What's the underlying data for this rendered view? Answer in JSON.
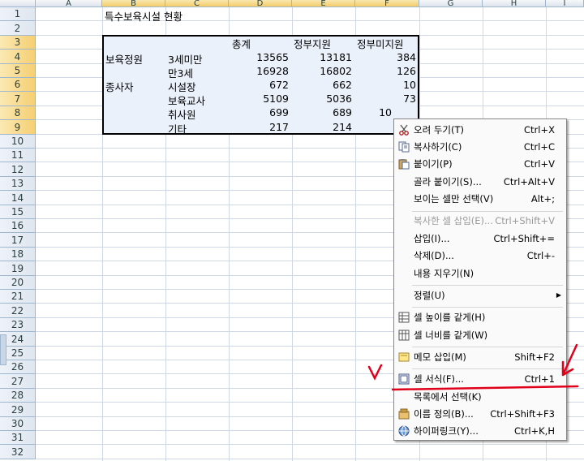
{
  "columns": [
    "A",
    "B",
    "C",
    "D",
    "E",
    "F",
    "G",
    "H",
    "I"
  ],
  "rows": [
    "1",
    "2",
    "3",
    "4",
    "5",
    "6",
    "7",
    "8",
    "9",
    "10",
    "11",
    "12",
    "13",
    "14",
    "15",
    "16",
    "17",
    "18",
    "19",
    "20",
    "21",
    "22",
    "23",
    "24",
    "25",
    "26",
    "27",
    "28",
    "29",
    "30",
    "31",
    "32"
  ],
  "sheet": {
    "title": "특수보육시설 현황",
    "headers": {
      "total": "총계",
      "gov": "정부지원",
      "nongov": "정부미지원"
    },
    "groups": {
      "g1": "보육정원",
      "g2": "종사자"
    },
    "table": [
      {
        "label": "3세미만",
        "total": "13565",
        "gov": "13181",
        "nongov": "384"
      },
      {
        "label": "만3세",
        "total": "16928",
        "gov": "16802",
        "nongov": "126"
      },
      {
        "label": "시설장",
        "total": "672",
        "gov": "662",
        "nongov": "10"
      },
      {
        "label": "보육교사",
        "total": "5109",
        "gov": "5036",
        "nongov": "73"
      },
      {
        "label": "취사원",
        "total": "699",
        "gov": "689",
        "nongov": "10"
      },
      {
        "label": "기타",
        "total": "217",
        "gov": "214",
        "nongov": ""
      }
    ]
  },
  "context_menu": {
    "cut": {
      "label": "오려 두기(T)",
      "shortcut": "Ctrl+X",
      "icon": "scissors-icon"
    },
    "copy": {
      "label": "복사하기(C)",
      "shortcut": "Ctrl+C",
      "icon": "copy-icon"
    },
    "paste": {
      "label": "붙이기(P)",
      "shortcut": "Ctrl+V",
      "icon": "paste-icon"
    },
    "paste_special": {
      "label": "골라 붙이기(S)...",
      "shortcut": "Ctrl+Alt+V"
    },
    "select_visible": {
      "label": "보이는 셀만 선택(V)",
      "shortcut": "Alt+;"
    },
    "insert_copied": {
      "label": "복사한 셀 삽입(E)...",
      "shortcut": "Ctrl+Shift+V"
    },
    "insert": {
      "label": "삽입(I)...",
      "shortcut": "Ctrl+Shift+="
    },
    "delete": {
      "label": "삭제(D)...",
      "shortcut": "Ctrl+-"
    },
    "clear": {
      "label": "내용 지우기(N)",
      "shortcut": ""
    },
    "sort": {
      "label": "정렬(U)",
      "shortcut": ""
    },
    "row_height": {
      "label": "셀 높이를 같게(H)",
      "shortcut": "",
      "icon": "equal-height-icon"
    },
    "col_width": {
      "label": "셀 너비를 같게(W)",
      "shortcut": "",
      "icon": "equal-width-icon"
    },
    "memo": {
      "label": "메모 삽입(M)",
      "shortcut": "Shift+F2",
      "icon": "memo-icon"
    },
    "format": {
      "label": "셀 서식(F)...",
      "shortcut": "Ctrl+1",
      "icon": "format-cells-icon"
    },
    "pick_list": {
      "label": "목록에서 선택(K)",
      "shortcut": ""
    },
    "define_name": {
      "label": "이름 정의(B)...",
      "shortcut": "Ctrl+Shift+F3",
      "icon": "name-define-icon"
    },
    "hyperlink": {
      "label": "하이퍼링크(Y)...",
      "shortcut": "Ctrl+K,H",
      "icon": "hyperlink-icon"
    }
  },
  "annotation_color": "#e0001a"
}
